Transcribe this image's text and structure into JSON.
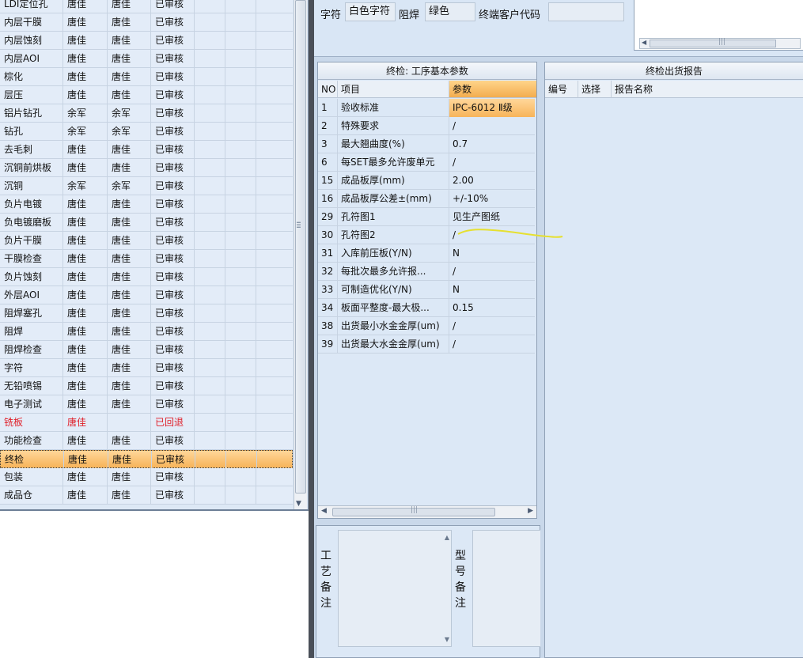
{
  "process_table": {
    "rows": [
      {
        "name": "LDI定位孔",
        "c2": "唐佳",
        "c3": "唐佳",
        "status": "已审核",
        "state": "normal"
      },
      {
        "name": "内层干膜",
        "c2": "唐佳",
        "c3": "唐佳",
        "status": "已审核",
        "state": "normal"
      },
      {
        "name": "内层蚀刻",
        "c2": "唐佳",
        "c3": "唐佳",
        "status": "已审核",
        "state": "normal"
      },
      {
        "name": "内层AOI",
        "c2": "唐佳",
        "c3": "唐佳",
        "status": "已审核",
        "state": "normal"
      },
      {
        "name": "棕化",
        "c2": "唐佳",
        "c3": "唐佳",
        "status": "已审核",
        "state": "normal"
      },
      {
        "name": "层压",
        "c2": "唐佳",
        "c3": "唐佳",
        "status": "已审核",
        "state": "normal"
      },
      {
        "name": "铝片钻孔",
        "c2": "余军",
        "c3": "余军",
        "status": "已审核",
        "state": "normal"
      },
      {
        "name": "钻孔",
        "c2": "余军",
        "c3": "余军",
        "status": "已审核",
        "state": "normal"
      },
      {
        "name": "去毛刺",
        "c2": "唐佳",
        "c3": "唐佳",
        "status": "已审核",
        "state": "normal"
      },
      {
        "name": "沉铜前烘板",
        "c2": "唐佳",
        "c3": "唐佳",
        "status": "已审核",
        "state": "normal"
      },
      {
        "name": "沉铜",
        "c2": "余军",
        "c3": "余军",
        "status": "已审核",
        "state": "normal"
      },
      {
        "name": "负片电镀",
        "c2": "唐佳",
        "c3": "唐佳",
        "status": "已审核",
        "state": "normal"
      },
      {
        "name": "负电镀磨板",
        "c2": "唐佳",
        "c3": "唐佳",
        "status": "已审核",
        "state": "normal"
      },
      {
        "name": "负片干膜",
        "c2": "唐佳",
        "c3": "唐佳",
        "status": "已审核",
        "state": "normal"
      },
      {
        "name": "干膜检查",
        "c2": "唐佳",
        "c3": "唐佳",
        "status": "已审核",
        "state": "normal"
      },
      {
        "name": "负片蚀刻",
        "c2": "唐佳",
        "c3": "唐佳",
        "status": "已审核",
        "state": "normal"
      },
      {
        "name": "外层AOI",
        "c2": "唐佳",
        "c3": "唐佳",
        "status": "已审核",
        "state": "normal"
      },
      {
        "name": "阻焊塞孔",
        "c2": "唐佳",
        "c3": "唐佳",
        "status": "已审核",
        "state": "normal"
      },
      {
        "name": "阻焊",
        "c2": "唐佳",
        "c3": "唐佳",
        "status": "已审核",
        "state": "normal"
      },
      {
        "name": "阻焊检查",
        "c2": "唐佳",
        "c3": "唐佳",
        "status": "已审核",
        "state": "normal"
      },
      {
        "name": "字符",
        "c2": "唐佳",
        "c3": "唐佳",
        "status": "已审核",
        "state": "normal"
      },
      {
        "name": "无铅喷锡",
        "c2": "唐佳",
        "c3": "唐佳",
        "status": "已审核",
        "state": "normal"
      },
      {
        "name": "电子测试",
        "c2": "唐佳",
        "c3": "唐佳",
        "status": "已审核",
        "state": "normal"
      },
      {
        "name": "铣板",
        "c2": "唐佳",
        "c3": "",
        "status": "已回退",
        "state": "returned"
      },
      {
        "name": "功能检查",
        "c2": "唐佳",
        "c3": "唐佳",
        "status": "已审核",
        "state": "normal"
      },
      {
        "name": "终检",
        "c2": "唐佳",
        "c3": "唐佳",
        "status": "已审核",
        "state": "selected"
      },
      {
        "name": "包装",
        "c2": "唐佳",
        "c3": "唐佳",
        "status": "已审核",
        "state": "normal"
      },
      {
        "name": "成品仓",
        "c2": "唐佳",
        "c3": "唐佳",
        "status": "已审核",
        "state": "normal"
      }
    ]
  },
  "top_fields": {
    "char_label": "字符",
    "char_value": "白色字符",
    "solder_label": "阻焊",
    "solder_value": "绿色",
    "customer_code_label": "终端客户代码",
    "customer_code_value": ""
  },
  "param_panel": {
    "title": "终检: 工序基本参数",
    "col_no": "NO",
    "col_item": "项目",
    "col_param": "参数",
    "rows": [
      {
        "no": "1",
        "item": "验收标准",
        "value": "IPC-6012 Ⅱ级"
      },
      {
        "no": "2",
        "item": "特殊要求",
        "value": "/"
      },
      {
        "no": "3",
        "item": "最大翘曲度(%)",
        "value": "0.7"
      },
      {
        "no": "6",
        "item": "每SET最多允许废单元",
        "value": "/"
      },
      {
        "no": "15",
        "item": "成品板厚(mm)",
        "value": "2.00"
      },
      {
        "no": "16",
        "item": "成品板厚公差±(mm)",
        "value": "+/-10%"
      },
      {
        "no": "29",
        "item": "孔符图1",
        "value": "见生产图纸"
      },
      {
        "no": "30",
        "item": "孔符图2",
        "value": "/"
      },
      {
        "no": "31",
        "item": "入库前压板(Y/N)",
        "value": "N"
      },
      {
        "no": "32",
        "item": "每批次最多允许报...",
        "value": "/"
      },
      {
        "no": "33",
        "item": "可制造优化(Y/N)",
        "value": "N"
      },
      {
        "no": "34",
        "item": "板面平整度-最大极...",
        "value": "0.15"
      },
      {
        "no": "38",
        "item": "出货最小水金金厚(um)",
        "value": "/"
      },
      {
        "no": "39",
        "item": "出货最大水金金厚(um)",
        "value": "/"
      }
    ]
  },
  "report_panel": {
    "title": "终检出货报告",
    "col_no": "编号",
    "col_select": "选择",
    "col_name": "报告名称"
  },
  "notes": {
    "process_label": "工艺备注",
    "model_label": "型号备注"
  },
  "colors": {
    "panel_bg": "#dce8f6",
    "selected_row": "#f7b45a",
    "returned_text": "#e0202a",
    "annotation": "#e6e030"
  }
}
